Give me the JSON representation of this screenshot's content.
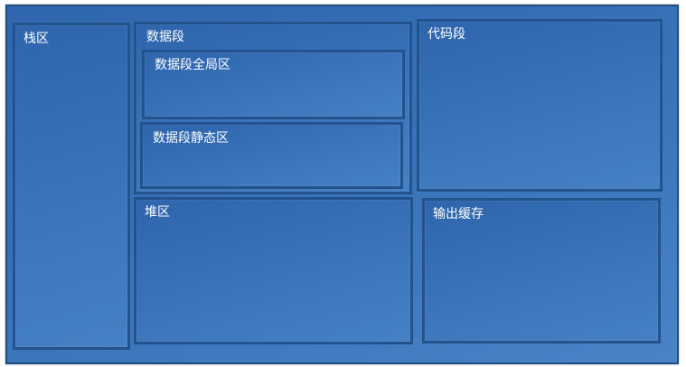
{
  "regions": {
    "stack": "栈区",
    "data_segment": "数据段",
    "data_global": "数据段全局区",
    "data_static": "数据段静态区",
    "code_segment": "代码段",
    "heap": "堆区",
    "output_buffer": "输出缓存"
  },
  "colors": {
    "fill": "#3a74b9",
    "border": "#23538d",
    "text": "#ffffff"
  }
}
